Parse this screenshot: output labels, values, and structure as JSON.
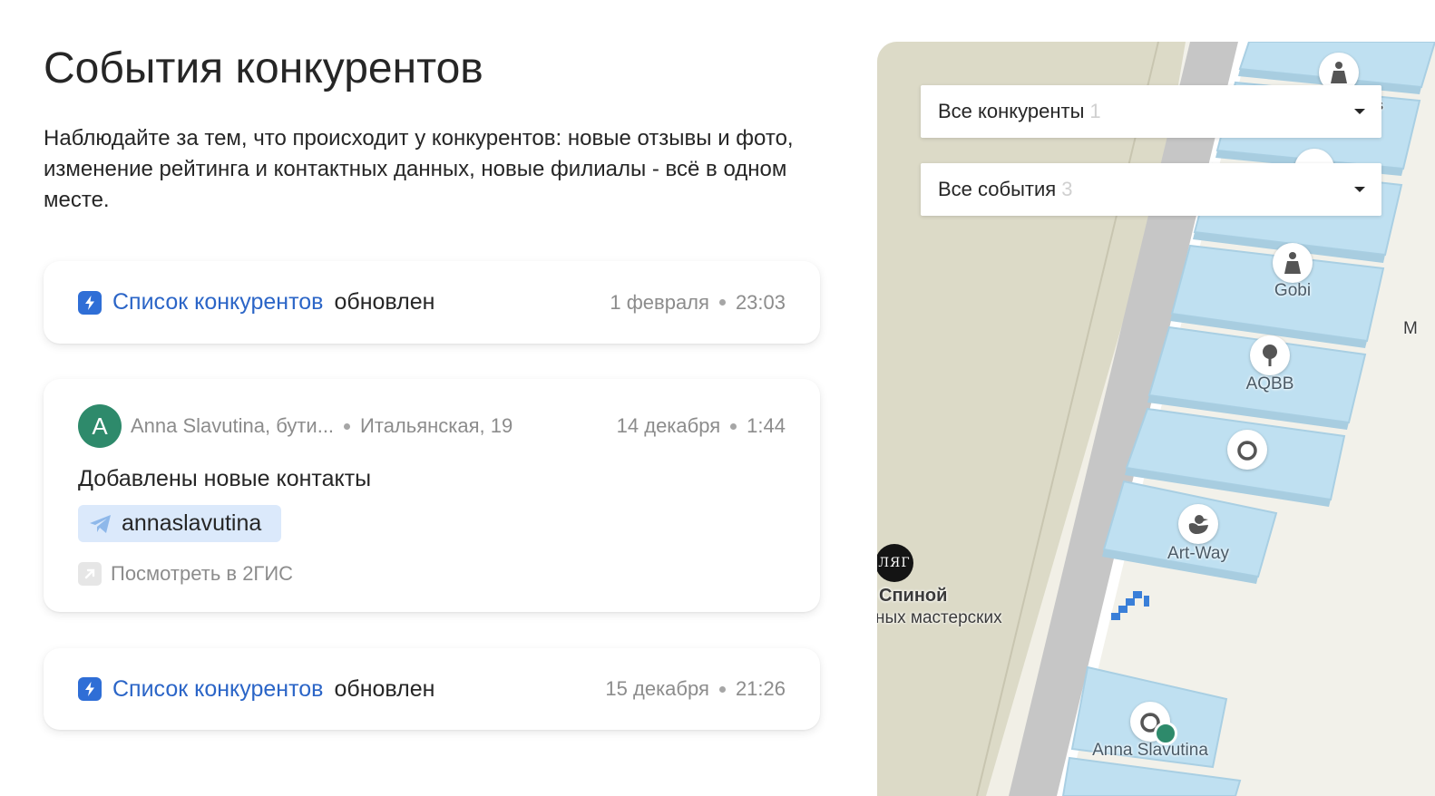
{
  "page": {
    "title": "События конкурентов",
    "description": "Наблюдайте за тем, что происходит у конкурентов: новые отзывы и фото, изменение рейтинга и контактных данных, новые филиалы - всё в одном месте."
  },
  "events": [
    {
      "link_text": "Список конкурентов",
      "suffix": "обновлен",
      "date": "1 февраля",
      "time": "23:03"
    },
    {
      "avatar_letter": "A",
      "company": "Anna Slavutina, бути...",
      "address": "Итальянская, 19",
      "date": "14 декабря",
      "time": "1:44",
      "event_text": "Добавлены новые контакты",
      "contact": "annaslavutina",
      "view_link": "Посмотреть в 2ГИС"
    },
    {
      "link_text": "Список конкурентов",
      "suffix": "обновлен",
      "date": "15 декабря",
      "time": "21:26"
    }
  ],
  "filters": {
    "competitors": {
      "label": "Все конкуренты",
      "count": "1"
    },
    "events": {
      "label": "Все события",
      "count": "3"
    }
  },
  "map": {
    "labels": {
      "gobi": "Gobi",
      "aqbb": "AQBB",
      "artway": "Art-Way",
      "anna": "Anna Slavutina",
      "spinoy": "Спиной",
      "masters": "ных мастерских",
      "lyag": "ЛЯГ",
      "edge_m": "M",
      "edge_s": "s"
    }
  },
  "colors": {
    "link": "#2b65c7",
    "accent_avatar": "#2e8a6b",
    "chip_bg": "#dbe9fb",
    "map_building": "#bfe0f1",
    "map_road": "#c9c9c9",
    "map_ground": "#dcdac7"
  }
}
